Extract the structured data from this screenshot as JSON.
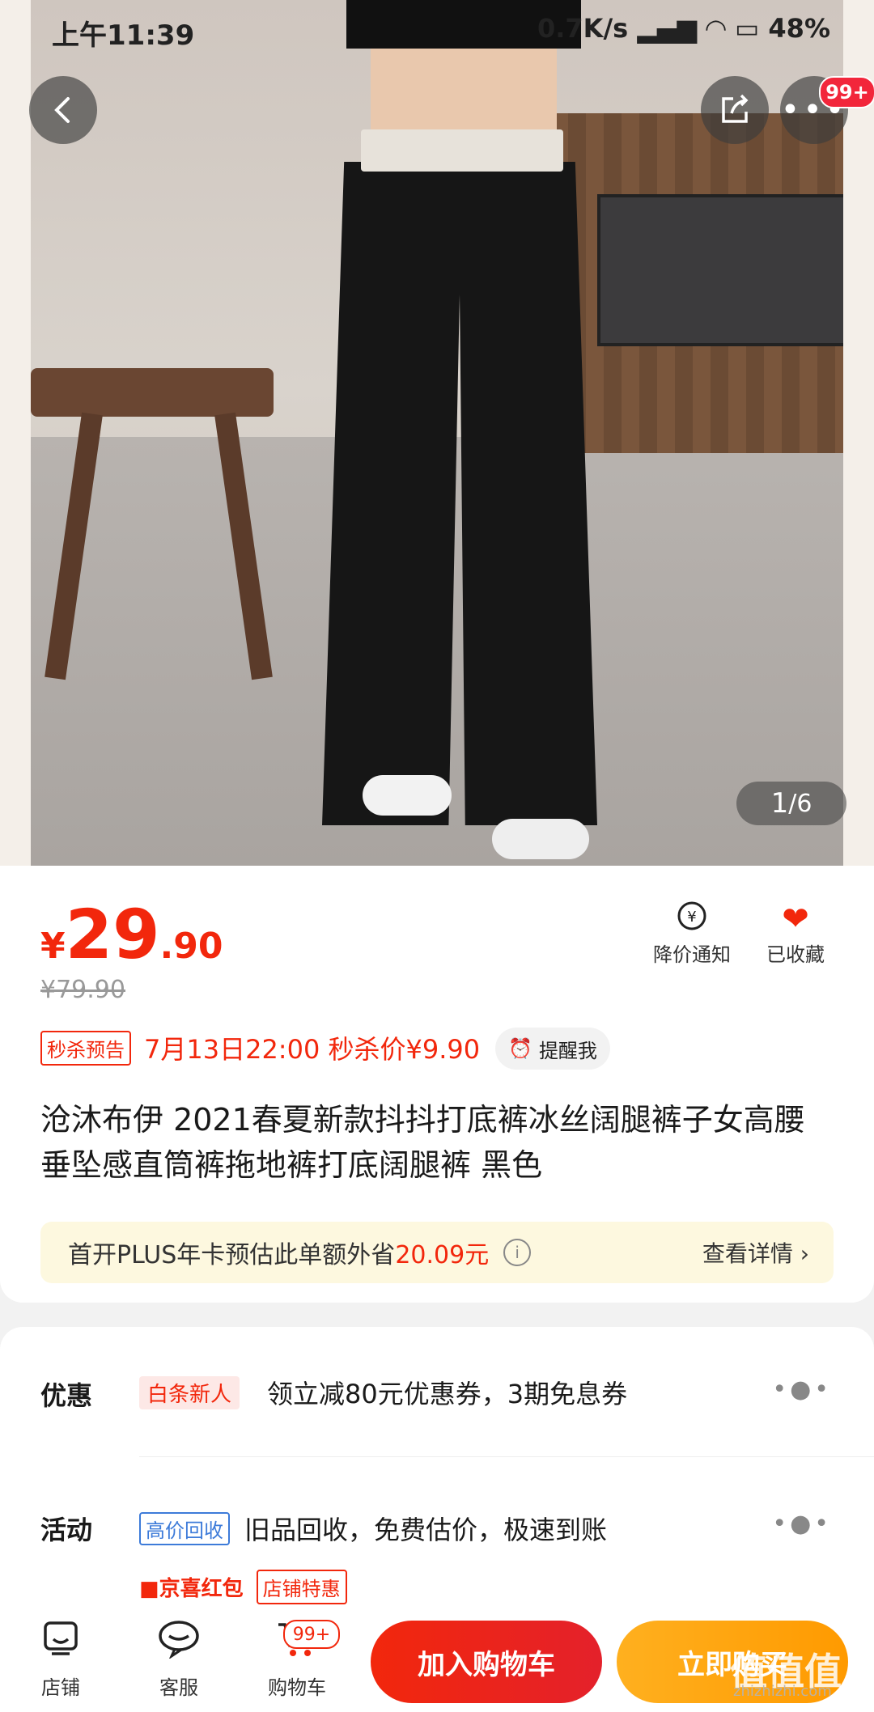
{
  "status_bar": {
    "time": "上午11:39",
    "network": "0.7K/s",
    "battery": "48%"
  },
  "gallery": {
    "current": "1",
    "total": "/6",
    "more_badge": "99+"
  },
  "price": {
    "currency": "¥",
    "integer": "29",
    "decimal": ".90",
    "original": "¥79.90"
  },
  "actions": {
    "price_alert": "降价通知",
    "favorited": "已收藏"
  },
  "flash_sale": {
    "tag": "秒杀预告",
    "text": "7月13日22:00 秒杀价¥9.90",
    "remind": "提醒我"
  },
  "product": {
    "title": "沧沐布伊 2021春夏新款抖抖打底裤冰丝阔腿裤子女高腰垂坠感直筒裤拖地裤打底阔腿裤 黑色"
  },
  "plus": {
    "text_prefix": "首开PLUS年卡预估此单额外省",
    "amount": "20.09元",
    "detail": "查看详情 ›"
  },
  "promo": {
    "label": "优惠",
    "tag": "白条新人",
    "text": "领立减80元优惠券，3期免息券"
  },
  "activity": {
    "label": "活动",
    "tag": "高价回收",
    "text": "旧品回收，免费估价，极速到账",
    "tag2": "京喜红包",
    "tag3": "店铺特惠"
  },
  "bottom_nav": {
    "shop": "店铺",
    "service": "客服",
    "cart": "购物车",
    "cart_badge": "99+",
    "add_to_cart": "加入购物车",
    "buy_now": "立即购买"
  },
  "watermark": {
    "main": "值值值",
    "sub": "zhizhizhi.com"
  },
  "colors": {
    "accent_red": "#f2270c",
    "accent_orange": "#ff9a00",
    "plus_bg": "#fdf8df"
  }
}
